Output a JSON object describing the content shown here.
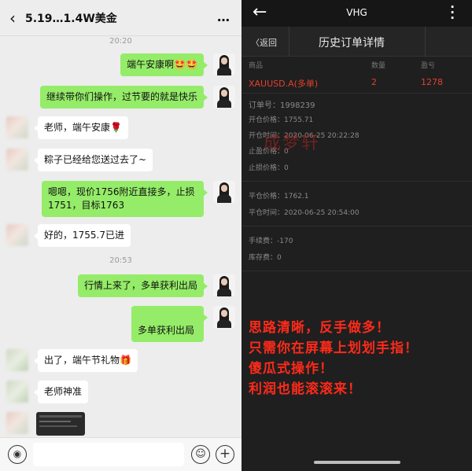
{
  "chat": {
    "title": "5.19…1.4W美金",
    "more_icon": "…",
    "back_icon": "‹",
    "timestamps": [
      "20:20",
      "20:53"
    ],
    "messages": [
      {
        "side": "right",
        "text": "端午安康啊🤩🤩"
      },
      {
        "side": "right",
        "text": "继续带你们操作，过节要的就是快乐"
      },
      {
        "side": "left",
        "text": "老师，端午安康🌹"
      },
      {
        "side": "left",
        "text": "粽子已经给您送过去了~"
      },
      {
        "side": "right",
        "text": "嗯嗯，现价1756附近直接多，止损1751，目标1763"
      },
      {
        "side": "left",
        "text": "好的，1755.7已进"
      },
      {
        "side": "right",
        "text": "行情上来了，多单获利出局"
      },
      {
        "side": "right",
        "text": "多单获利出局"
      },
      {
        "side": "left",
        "text": "出了，端午节礼物🎁"
      },
      {
        "side": "left",
        "text": "老师神准"
      }
    ],
    "input": {
      "voice_icon": "◉",
      "emoji_icon": "☺",
      "plus_icon": "+"
    }
  },
  "detail": {
    "app_name": "VHG",
    "return_label": "〈返回",
    "page_title": "历史订单详情",
    "columns": {
      "product": "商品",
      "quantity": "数量",
      "profit": "盈亏"
    },
    "order": {
      "symbol": "XAUUSD.A(多单)",
      "quantity": "2",
      "profit": "1278"
    },
    "fields": [
      {
        "label": "订单号：",
        "value": "1998239"
      },
      {
        "label": "开仓价格：",
        "value": "1755.71"
      },
      {
        "label": "开仓时间：",
        "value": "2020-06-25 20:22:28"
      },
      {
        "label": "止盈价格：",
        "value": "0"
      },
      {
        "label": "止损价格：",
        "value": "0"
      },
      {
        "label": "平仓价格：",
        "value": "1762.1"
      },
      {
        "label": "平仓时间：",
        "value": "2020-06-25 20:54:00"
      },
      {
        "label": "手续费：",
        "value": "-170"
      },
      {
        "label": "库存费：",
        "value": "0"
      }
    ],
    "watermark": "成梦轩",
    "promo_lines": [
      "思路清晰，反手做多！",
      "只需你在屏幕上划划手指！",
      "傻瓜式操作！",
      "利润也能滚滚来！"
    ]
  },
  "colors": {
    "chat_bg": "#ededed",
    "bubble_green": "#95ec69",
    "detail_bg": "#1f1f1f",
    "symbol_red": "#e0402e",
    "promo_red": "#ff2a1a"
  }
}
